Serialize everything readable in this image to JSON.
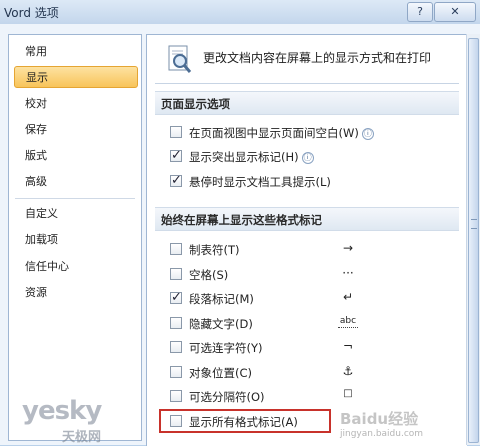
{
  "window": {
    "title": "Vord 选项",
    "help_label": "?",
    "close_label": "✕"
  },
  "sidebar": {
    "items": [
      {
        "label": "常用",
        "selected": false
      },
      {
        "label": "显示",
        "selected": true
      },
      {
        "label": "校对",
        "selected": false
      },
      {
        "label": "保存",
        "selected": false
      },
      {
        "label": "版式",
        "selected": false
      },
      {
        "label": "高级",
        "selected": false
      },
      {
        "label": "自定义",
        "selected": false
      },
      {
        "label": "加载项",
        "selected": false
      },
      {
        "label": "信任中心",
        "selected": false
      },
      {
        "label": "资源",
        "selected": false
      }
    ]
  },
  "main": {
    "header_icon": "magnifier-document-icon",
    "header_text": "更改文档内容在屏幕上的显示方式和在打印",
    "page_display": {
      "title": "页面显示选项",
      "options": [
        {
          "label": "在页面视图中显示页面间空白(W)",
          "checked": false,
          "info": "ⓘ"
        },
        {
          "label": "显示突出显示标记(H)",
          "checked": true,
          "info": "ⓘ"
        },
        {
          "label": "悬停时显示文档工具提示(L)",
          "checked": true
        }
      ]
    },
    "formatting_marks": {
      "title": "始终在屏幕上显示这些格式标记",
      "options": [
        {
          "label": "制表符(T)",
          "checked": false,
          "mark": "→"
        },
        {
          "label": "空格(S)",
          "checked": false,
          "mark": "···"
        },
        {
          "label": "段落标记(M)",
          "checked": true,
          "mark": "↵"
        },
        {
          "label": "隐藏文字(D)",
          "checked": false,
          "mark": "abc"
        },
        {
          "label": "可选连字符(Y)",
          "checked": false,
          "mark": "¬"
        },
        {
          "label": "对象位置(C)",
          "checked": false,
          "mark": "⚓"
        },
        {
          "label": "可选分隔符(O)",
          "checked": false,
          "mark": "□"
        },
        {
          "label": "显示所有格式标记(A)",
          "checked": false,
          "highlighted": true
        }
      ]
    }
  },
  "watermarks": {
    "left_top": "yesky",
    "left_bottom": "天极网",
    "right_top": "Baidu经验",
    "right_bottom": "jingyan.baidu.com"
  },
  "colors": {
    "selection": "#f8c45a",
    "highlight_box": "#c8322b",
    "panel_border": "#9fb6d3"
  }
}
